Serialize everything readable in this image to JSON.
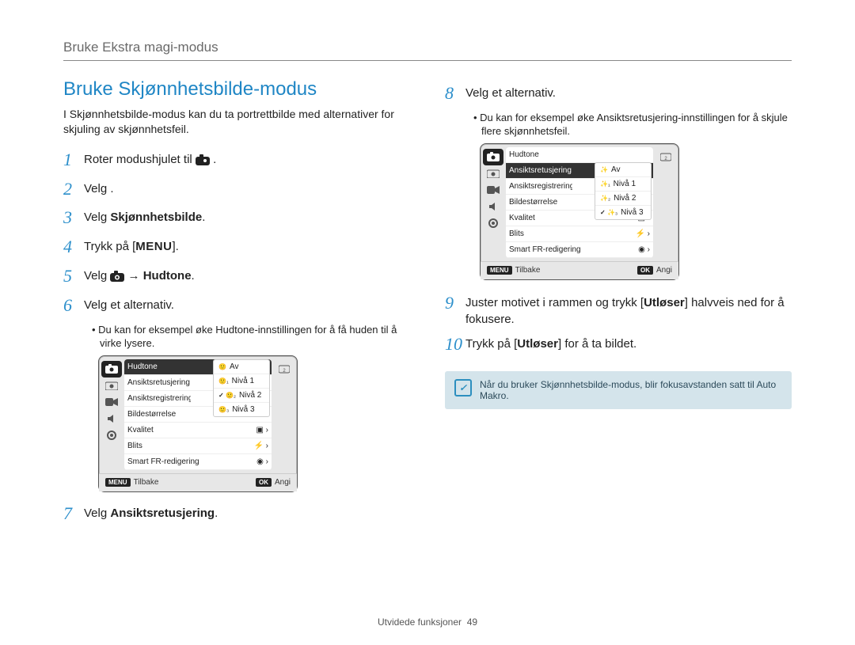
{
  "breadcrumb": "Bruke Ekstra magi-modus",
  "title": "Bruke Skjønnhetsbilde-modus",
  "intro": "I Skjønnhetsbilde-modus kan du ta portrettbilde med alternativer for skjuling av skjønnhetsfeil.",
  "steps": {
    "s1_pre": "Roter modushjulet til ",
    "s1_post": ".",
    "s2": "Velg      .",
    "s3_pre": "Velg ",
    "s3_b": "Skjønnhetsbilde",
    "s3_post": ".",
    "s4_pre": "Trykk på [",
    "s4_b": "MENU",
    "s4_post": "].",
    "s5_pre": "Velg ",
    "s5_arrow": " → ",
    "s5_b": "Hudtone",
    "s5_post": ".",
    "s6": "Velg et alternativ.",
    "s6_note": "Du kan for eksempel øke Hudtone-innstillingen for å få huden til å virke lysere.",
    "s7_pre": "Velg ",
    "s7_b": "Ansiktsretusjering",
    "s7_post": ".",
    "s8": "Velg et alternativ.",
    "s8_note": "Du kan for eksempel øke Ansiktsretusjering-innstillingen for å skjule flere skjønnhetsfeil.",
    "s9_pre": "Juster motivet i rammen og trykk [",
    "s9_b": "Utløser",
    "s9_post": "] halvveis ned for å fokusere.",
    "s10_pre": "Trykk på [",
    "s10_b": "Utløser",
    "s10_post": "] for å ta bildet."
  },
  "lcd1": {
    "rows": [
      "Hudtone",
      "Ansiktsretusjering",
      "Ansiktsregistrering",
      "Bildestørrelse",
      "Kvalitet",
      "Blits",
      "Smart FR-redigering"
    ],
    "popup_head": "Av",
    "popup": [
      "Nivå 1",
      "Nivå 2",
      "Nivå 3"
    ],
    "popup_sel": 1,
    "back_badge": "MENU",
    "back": "Tilbake",
    "ok_badge": "OK",
    "ok": "Angi"
  },
  "lcd2": {
    "rows": [
      "Hudtone",
      "Ansiktsretusjering",
      "Ansiktsregistrering",
      "Bildestørrelse",
      "Kvalitet",
      "Blits",
      "Smart FR-redigering"
    ],
    "popup_head": "Av",
    "popup": [
      "Nivå 1",
      "Nivå 2",
      "Nivå 3"
    ],
    "popup_sel": 2,
    "back_badge": "MENU",
    "back": "Tilbake",
    "ok_badge": "OK",
    "ok": "Angi"
  },
  "note": "Når du bruker Skjønnhetsbilde-modus, blir fokusavstanden satt til Auto Makro.",
  "footer": {
    "label": "Utvidede funksjoner",
    "page": "49"
  }
}
